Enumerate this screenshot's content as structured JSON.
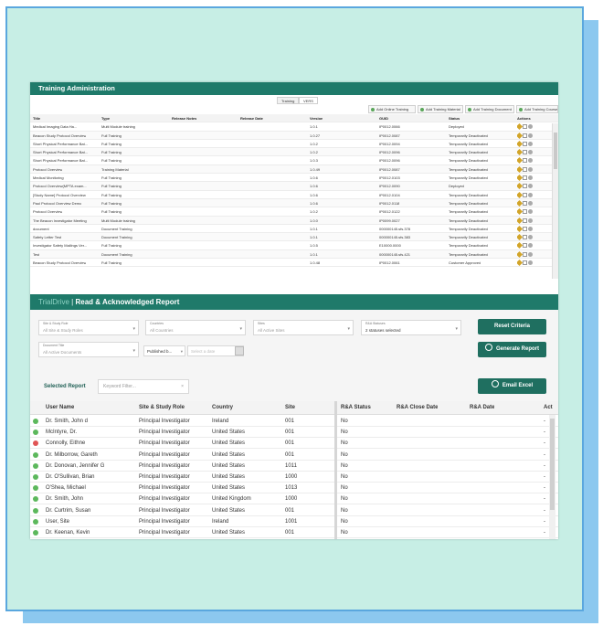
{
  "training_admin": {
    "title": "Training Administration",
    "tabs": [
      "Training",
      "VERS"
    ],
    "actions": [
      "Add Online Training",
      "Add Training Material",
      "Add Training Document",
      "Add Training Course"
    ],
    "columns": [
      "Title",
      "Type",
      "Release Notes",
      "Release Date",
      "Version",
      "GUID",
      "Status",
      "Actions"
    ],
    "rows": [
      [
        "Medical Imaging Data Ha...",
        "Multi Module training",
        "",
        "",
        "1.0.1",
        "IP0012.0066",
        "Deployed"
      ],
      [
        "Beacon Study Protocol Overview",
        "Full Training",
        "",
        "",
        "1.0.27",
        "IP0012.0087",
        "Temporarily Deactivated"
      ],
      [
        "Short Physical Performance Bat...",
        "Full Training",
        "",
        "",
        "1.0.2",
        "IP0012.0094",
        "Temporarily Deactivated"
      ],
      [
        "Short Physical Performance Bat...",
        "Full Training",
        "",
        "",
        "1.0.2",
        "IP0012.0096",
        "Temporarily Deactivated"
      ],
      [
        "Short Physical Performance Bat...",
        "Full Training",
        "",
        "",
        "1.0.3",
        "IP0012.0096",
        "Temporarily Deactivated"
      ],
      [
        "Protocol Overview",
        "Training Material",
        "",
        "",
        "1.0.49",
        "IP0012.0087",
        "Temporarily Deactivated"
      ],
      [
        "Medical Monitoring",
        "Full Training",
        "",
        "",
        "1.0.6",
        "IP0012.0103",
        "Temporarily Deactivated"
      ],
      [
        "Protocol Overview(MPTA exam...",
        "Full Training",
        "",
        "",
        "1.0.6",
        "IP0012.0090",
        "Deployed"
      ],
      [
        "[Study Name] Protocol Overview",
        "Full Training",
        "",
        "",
        "1.0.6",
        "IP0012.0104",
        "Temporarily Deactivated"
      ],
      [
        "Paul Protocol Overview Demo",
        "Full Training",
        "",
        "",
        "1.0.6",
        "IP0012.0118",
        "Temporarily Deactivated"
      ],
      [
        "Protocol Overview",
        "Full Training",
        "",
        "",
        "1.0.2",
        "IP0012.0122",
        "Temporarily Deactivated"
      ],
      [
        "The Beacon Investigator Meeting",
        "Multi Module training",
        "",
        "",
        "1.0.0",
        "IP0099.0027",
        "Temporarily Deactivated"
      ],
      [
        "document",
        "Document Training",
        "",
        "",
        "1.0.1",
        "000000145.sfs.378",
        "Temporarily Deactivated"
      ],
      [
        "Safety Letter Test",
        "Document Training",
        "",
        "",
        "1.0.1",
        "000000145.sfs.383",
        "Temporarily Deactivated"
      ],
      [
        "Investigator Safety Mailings Ver...",
        "Full Training",
        "",
        "",
        "1.0.5",
        "E10000.0000",
        "Temporarily Deactivated"
      ],
      [
        "Test",
        "Document Training",
        "",
        "",
        "1.0.1",
        "000000145.sfs.421",
        "Temporarily Deactivated"
      ],
      [
        "Beacon Study Protocol Overview",
        "Full Training",
        "",
        "",
        "1.0.48",
        "IP0012.0061",
        "Customer Approved"
      ]
    ]
  },
  "report": {
    "brand": "TrialDrive",
    "separator": " | ",
    "title": "Read & Acknowledged Report",
    "filters": {
      "site_role_label": "Site & Study Role",
      "site_role_value": "All Site & Study Roles",
      "countries_label": "Countries",
      "countries_value": "All Countries",
      "sites_label": "Sites",
      "sites_value": "All Active Sites",
      "ra_statuses_label": "R&A Statuses",
      "ra_statuses_value": "2 statuses selected",
      "document_title_label": "Document Title",
      "document_title_value": "All Active Documents",
      "published_label": "Published b...",
      "date_placeholder": "Select a date"
    },
    "buttons": {
      "reset": "Reset Criteria",
      "generate": "Generate Report",
      "email": "Email Excel"
    },
    "selected_report_label": "Selected Report",
    "keyword_placeholder": "Keyword Filter...",
    "keyword_clear": "×",
    "columns": [
      "User Name",
      "Site & Study Role",
      "Country",
      "Site",
      "R&A Status",
      "R&A Close Date",
      "R&A Date",
      "Act"
    ],
    "rows": [
      {
        "status_color": "#5cb85c",
        "user": "Dr. Smith, John d",
        "role": "Principal Investigator",
        "country": "Ireland",
        "site": "001",
        "ra_status": "No",
        "close": "",
        "date": "",
        "act": "-"
      },
      {
        "status_color": "#5cb85c",
        "user": "McIntyre, Dr.",
        "role": "Principal Investigator",
        "country": "United States",
        "site": "001",
        "ra_status": "No",
        "close": "",
        "date": "",
        "act": "-"
      },
      {
        "status_color": "#e05555",
        "user": "Connolly, Eithne",
        "role": "Principal Investigator",
        "country": "United States",
        "site": "001",
        "ra_status": "No",
        "close": "",
        "date": "",
        "act": "-"
      },
      {
        "status_color": "#5cb85c",
        "user": "Dr. Milborrow, Gareth",
        "role": "Principal Investigator",
        "country": "United States",
        "site": "001",
        "ra_status": "No",
        "close": "",
        "date": "",
        "act": "-"
      },
      {
        "status_color": "#5cb85c",
        "user": "Dr. Donovan, Jennifer G",
        "role": "Principal Investigator",
        "country": "United States",
        "site": "1011",
        "ra_status": "No",
        "close": "",
        "date": "",
        "act": "-"
      },
      {
        "status_color": "#5cb85c",
        "user": "Dr. O'Sullivan, Brian",
        "role": "Principal Investigator",
        "country": "United States",
        "site": "1000",
        "ra_status": "No",
        "close": "",
        "date": "",
        "act": "-"
      },
      {
        "status_color": "#5cb85c",
        "user": "O'Shea, Michael",
        "role": "Principal Investigator",
        "country": "United States",
        "site": "1013",
        "ra_status": "No",
        "close": "",
        "date": "",
        "act": "-"
      },
      {
        "status_color": "#5cb85c",
        "user": "Dr. Smith, John",
        "role": "Principal Investigator",
        "country": "United Kingdom",
        "site": "1000",
        "ra_status": "No",
        "close": "",
        "date": "",
        "act": "-"
      },
      {
        "status_color": "#5cb85c",
        "user": "Dr. Curtrim, Susan",
        "role": "Principal Investigator",
        "country": "United States",
        "site": "001",
        "ra_status": "No",
        "close": "",
        "date": "",
        "act": "-"
      },
      {
        "status_color": "#5cb85c",
        "user": "User, Site",
        "role": "Principal Investigator",
        "country": "Ireland",
        "site": "1001",
        "ra_status": "No",
        "close": "",
        "date": "",
        "act": "-"
      },
      {
        "status_color": "#5cb85c",
        "user": "Dr. Keenan, Kevin",
        "role": "Principal Investigator",
        "country": "United States",
        "site": "001",
        "ra_status": "No",
        "close": "",
        "date": "",
        "act": "-"
      }
    ]
  }
}
